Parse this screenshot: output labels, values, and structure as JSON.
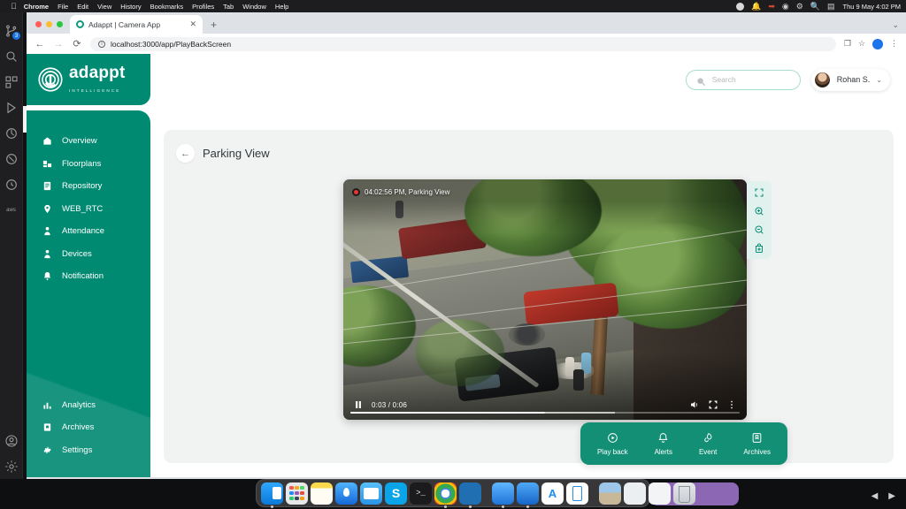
{
  "os": {
    "menubar": {
      "apple_icon": "apple-logo-icon",
      "app_name": "Chrome",
      "menus": [
        "File",
        "Edit",
        "View",
        "History",
        "Bookmarks",
        "Profiles",
        "Tab",
        "Window",
        "Help"
      ],
      "status_icons": [
        "shield-check-icon",
        "bell-icon",
        "logout-icon",
        "grammarly-icon",
        "vpn-icon",
        "spotlight-search-icon",
        "control-center-icon"
      ],
      "clock": "Thu 9 May  4:02 PM"
    },
    "dock": {
      "items": [
        "finder-icon",
        "launchpad-icon",
        "notes-icon",
        "maps-icon",
        "mail-icon",
        "skype-icon",
        "terminal-icon",
        "chrome-icon",
        "vscode-icon",
        "xcode-icon",
        "simulator-icon",
        "app-store-icon",
        "sim-device-icon",
        "minimized-photos-window",
        "minimized-chrome-window",
        "minimized-browser-window",
        "trash-icon"
      ],
      "skype_glyph": "S",
      "terminal_glyph": ">_",
      "appstore_glyph": "A",
      "vscode_glyph": "⬡"
    }
  },
  "browser": {
    "tab": {
      "title": "Adappt | Camera App",
      "favicon": "adappt-favicon",
      "close_glyph": "✕"
    },
    "new_tab_glyph": "+",
    "window_chevron": "⌄",
    "nav": {
      "back": "←",
      "forward": "→",
      "reload": "⟳"
    },
    "url": "localhost:3000/app/PlayBackScreen",
    "url_info_glyph": "i",
    "toolbar_icons": [
      "install-app-icon",
      "bookmark-star-icon",
      "profile-avatar-icon",
      "chrome-menu-icon"
    ],
    "star_glyph": "☆",
    "install_glyph": "❐",
    "menu_glyph": "⋮"
  },
  "app": {
    "logo": {
      "word": "adappt",
      "sub": "INTELLIGENCE",
      "mark": "adappt-spiral-logo-icon"
    },
    "search": {
      "placeholder": "Search",
      "icon": "search-icon"
    },
    "user": {
      "name": "Rohan S.",
      "avatar": "user-avatar",
      "chevron": "⌄"
    },
    "sidebar": {
      "primary": [
        {
          "label": "Overview",
          "icon": "home-icon"
        },
        {
          "label": "Floorplans",
          "icon": "floorplan-icon"
        },
        {
          "label": "Repository",
          "icon": "repository-icon"
        },
        {
          "label": "WEB_RTC",
          "icon": "location-pin-icon"
        },
        {
          "label": "Attendance",
          "icon": "person-icon"
        },
        {
          "label": "Devices",
          "icon": "devices-person-icon"
        },
        {
          "label": "Notification",
          "icon": "bell-icon"
        }
      ],
      "secondary": [
        {
          "label": "Analytics",
          "icon": "bar-chart-icon"
        },
        {
          "label": "Archives",
          "icon": "archive-bookmark-icon"
        },
        {
          "label": "Settings",
          "icon": "gear-icon"
        }
      ]
    },
    "page": {
      "back_glyph": "←",
      "title": "Parking View"
    },
    "video": {
      "stamp_time": "04:02:56 PM",
      "stamp_camera": "Parking View",
      "stamp_text": "04:02:56 PM, Parking View",
      "record_indicator": "record-dot-icon",
      "controls": {
        "play_state_icon": "pause-icon",
        "time_display": "0:03 / 0:06",
        "current_time": "0:03",
        "duration": "0:06",
        "progress_percent": 50,
        "buffered_percent": 68,
        "volume_icon": "volume-icon",
        "fullscreen_icon": "fullscreen-icon",
        "more_icon": "more-options-icon"
      },
      "tools": [
        {
          "icon": "expand-fullscreen-icon"
        },
        {
          "icon": "zoom-in-icon"
        },
        {
          "icon": "zoom-out-icon"
        },
        {
          "icon": "snapshot-lock-icon"
        }
      ]
    },
    "bottom_tabs": [
      {
        "label": "Play back",
        "icon": "playback-icon"
      },
      {
        "label": "Alerts",
        "icon": "bell-icon"
      },
      {
        "label": "Event",
        "icon": "event-layers-icon"
      },
      {
        "label": "Archives",
        "icon": "bookmark-icon"
      }
    ],
    "colors": {
      "brand_teal": "#018a72",
      "tabbar_teal": "#128f74",
      "content_bg": "#f1f2f2",
      "search_border": "#a8dcd0",
      "tool_panel": "#e0f1ed",
      "record_red": "#ee3333"
    }
  }
}
